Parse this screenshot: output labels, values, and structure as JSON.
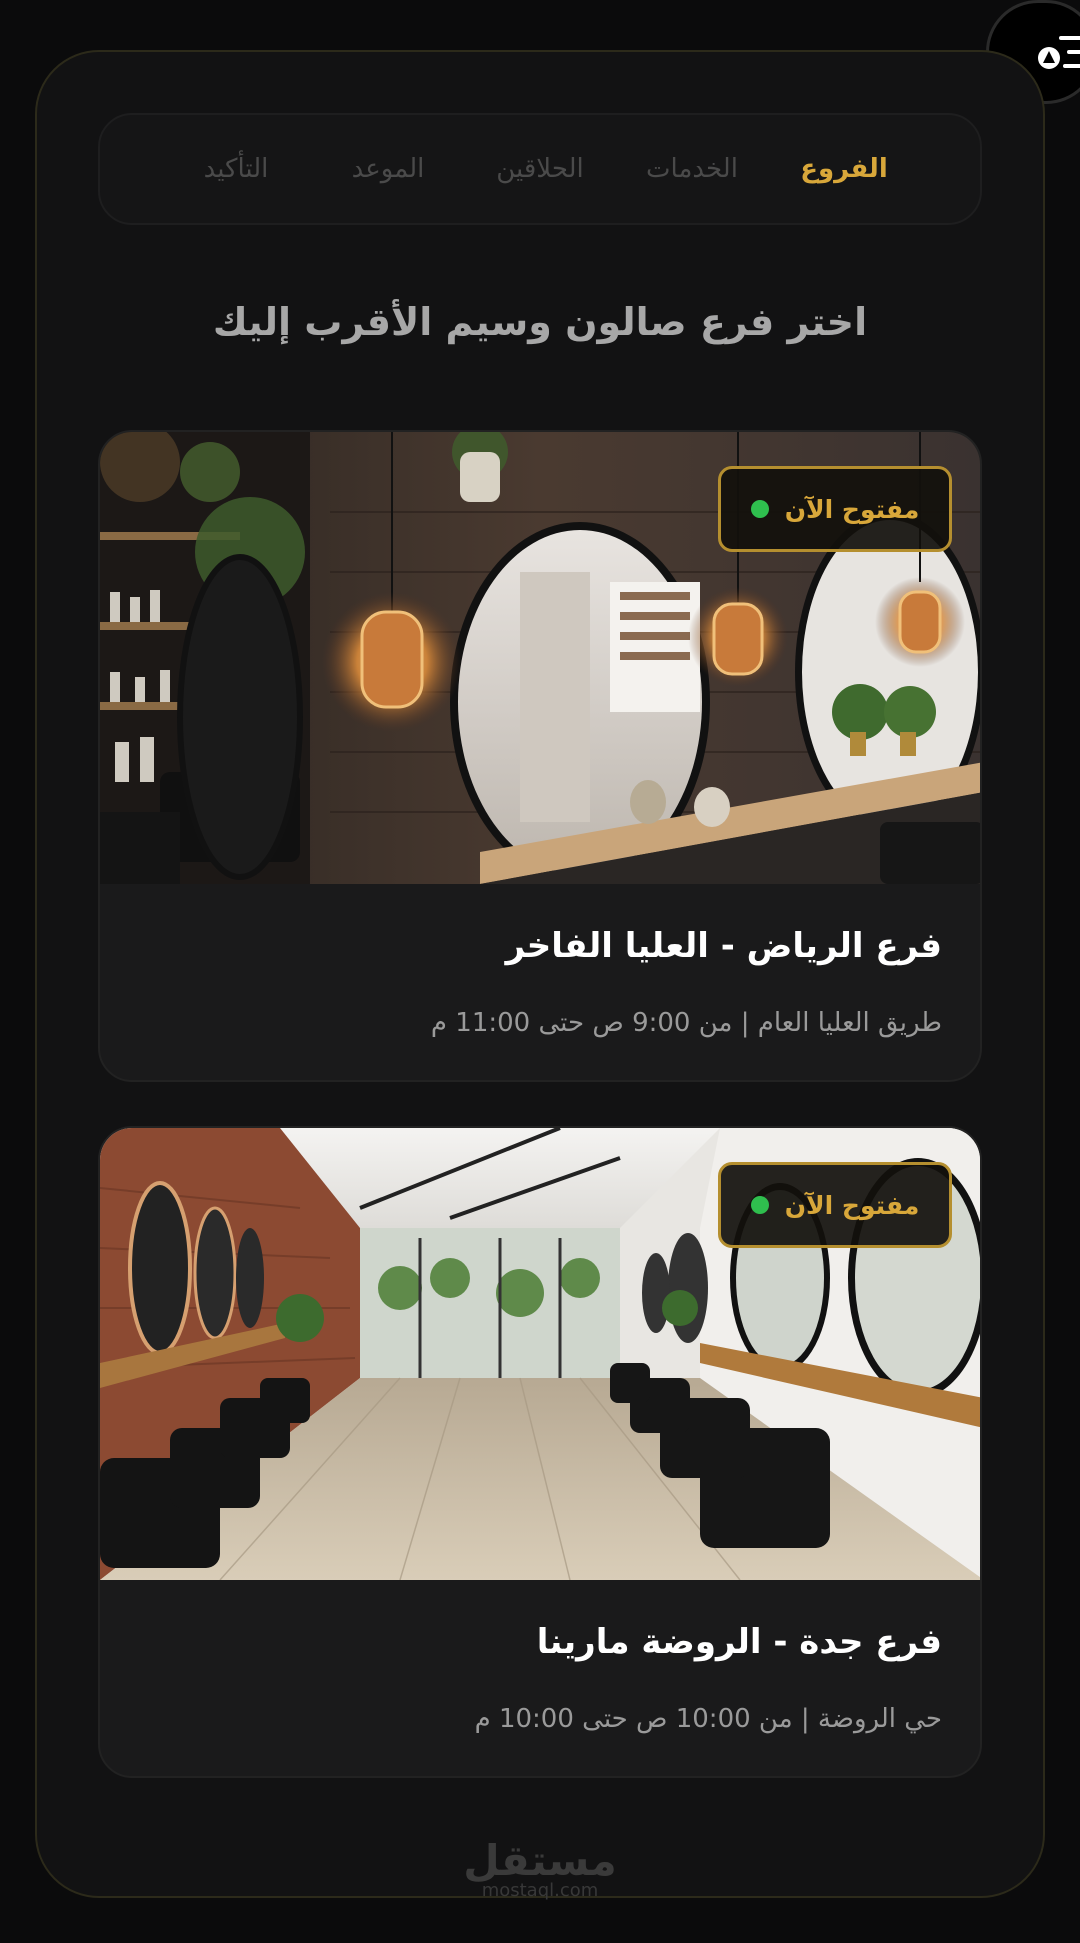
{
  "steps": [
    {
      "label": "الفروع",
      "active": true
    },
    {
      "label": "الخدمات",
      "active": false
    },
    {
      "label": "الحلاقين",
      "active": false
    },
    {
      "label": "الموعد",
      "active": false
    },
    {
      "label": "التأكيد",
      "active": false
    }
  ],
  "heading": "اختر فرع صالون وسيم الأقرب إليك",
  "branches": [
    {
      "name": "فرع الرياض - العليا الفاخر",
      "details": "طريق العليا العام | من 9:00 ص حتى 11:00 م",
      "status": "مفتوح الآن"
    },
    {
      "name": "فرع جدة - الروضة مارينا",
      "details": "حي الروضة | من 10:00 ص حتى 10:00 م",
      "status": "مفتوح الآن"
    }
  ],
  "watermark": {
    "arabic": "مستقل",
    "latin": "mostaql.com"
  },
  "icons": {
    "menu": "menu-lines-icon",
    "status": "status-dot-icon"
  },
  "colors": {
    "accent": "#d8a73a",
    "open": "#2fbf4e",
    "background": "#0b0b0c",
    "card": "#1a1a1b"
  }
}
